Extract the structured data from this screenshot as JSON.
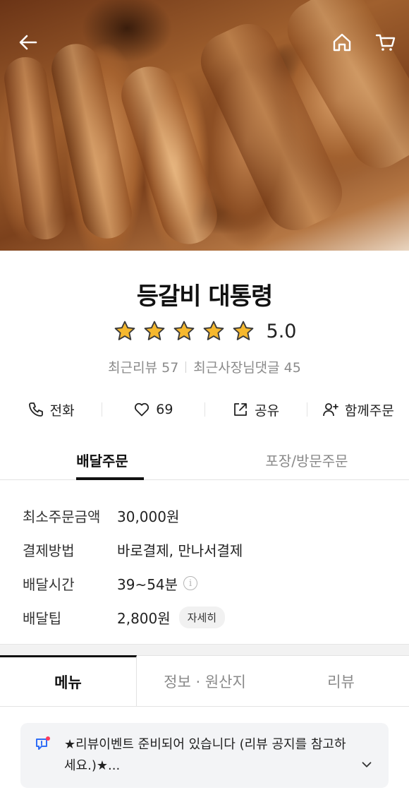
{
  "header": {
    "back_icon": "back-arrow-icon",
    "home_icon": "home-icon",
    "cart_icon": "cart-icon"
  },
  "store": {
    "name": "등갈비 대통령",
    "rating": "5.0",
    "stars": 5,
    "recent_reviews": "최근리뷰 57",
    "owner_replies": "최근사장님댓글 45"
  },
  "actions": {
    "call": "전화",
    "likes": "69",
    "share": "공유",
    "group_order": "함께주문"
  },
  "order_tabs": {
    "delivery": "배달주문",
    "pickup": "포장/방문주문"
  },
  "info": {
    "rows": [
      {
        "key": "최소주문금액",
        "value": "30,000원"
      },
      {
        "key": "결제방법",
        "value": "바로결제, 만나서결제"
      },
      {
        "key": "배달시간",
        "value": "39~54분"
      },
      {
        "key": "배달팁",
        "value": "2,800원"
      }
    ],
    "detail_button": "자세히",
    "info_icon_glyph": "i"
  },
  "menu_tabs": {
    "menu": "메뉴",
    "info_origin": "정보 · 원산지",
    "review": "리뷰"
  },
  "notice": {
    "text": "★리뷰이벤트 준비되어 있습니다 (리뷰 공지를 참고하세요.)★..."
  },
  "colors": {
    "star_fill": "#F5B82E",
    "star_stroke": "#3a3a3a",
    "notice_icon": "#2f6df6",
    "notice_dot": "#ff3b5c"
  }
}
